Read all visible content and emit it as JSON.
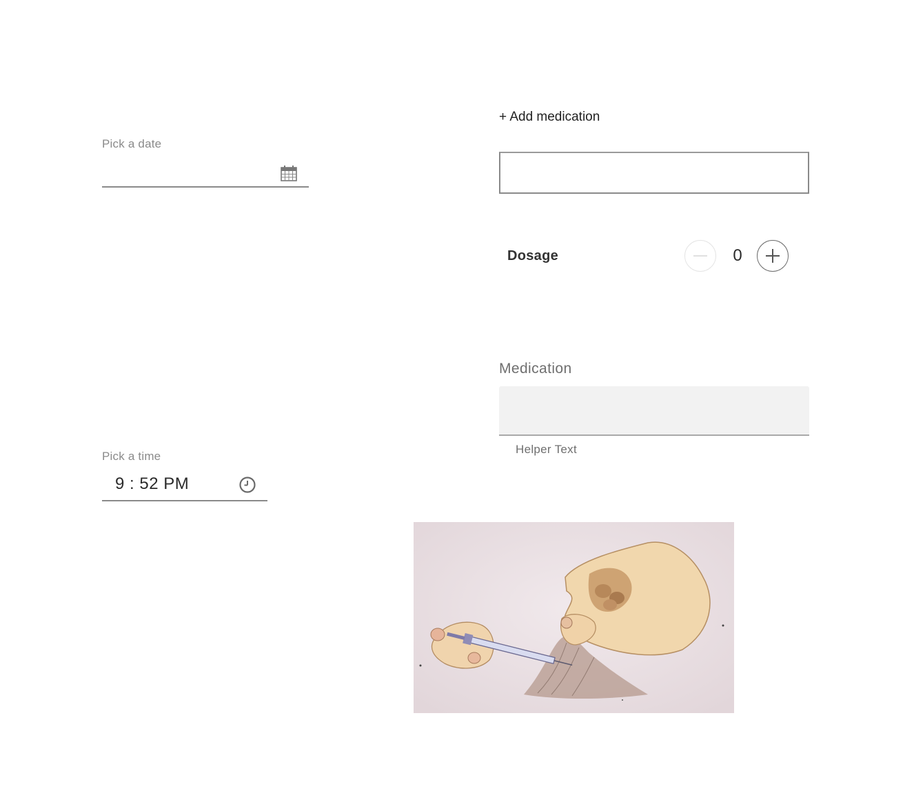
{
  "date_picker": {
    "label": "Pick a date",
    "value": "",
    "icon": "calendar-icon"
  },
  "time_picker": {
    "label": "Pick a time",
    "value": "9 : 52 PM",
    "icon": "clock-icon"
  },
  "medication_form": {
    "add_label": "+ Add medication",
    "input_value": ""
  },
  "dosage": {
    "label": "Dosage",
    "value": "0",
    "decrement_icon": "minus-icon",
    "increment_icon": "plus-icon"
  },
  "medication_field": {
    "label": "Medication",
    "value": "",
    "helper_text": "Helper Text"
  },
  "colors": {
    "border": "#8a8a8a",
    "filled_bg": "#f2f2f2",
    "illustration_bg": "#ece2e4"
  }
}
